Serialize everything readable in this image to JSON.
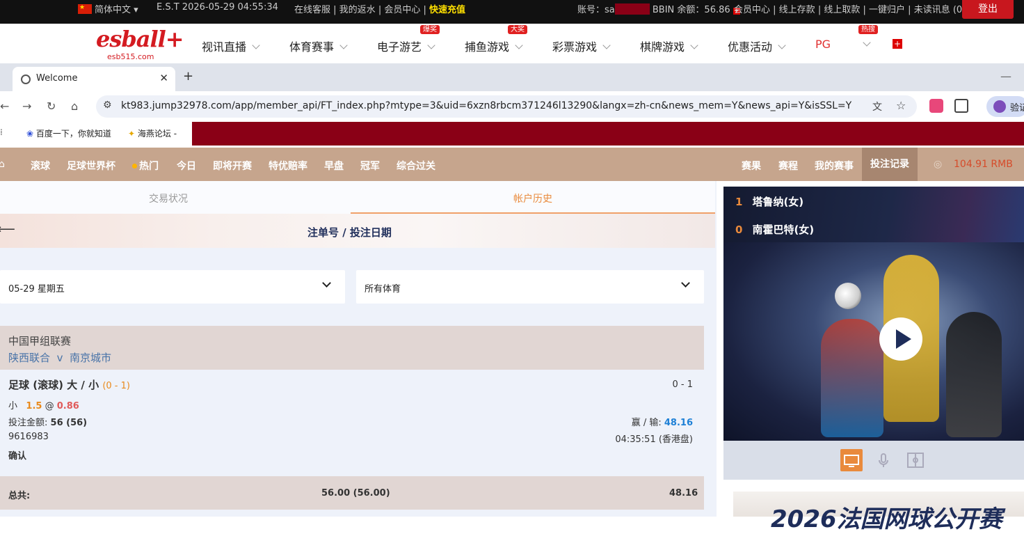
{
  "topbar": {
    "lang": "简体中文",
    "time": "E.S.T 2026-05-29 04:55:34",
    "links": [
      "在线客服",
      "我的返水",
      "会员中心"
    ],
    "recharge": "快速充值",
    "account_label": "账号：sa",
    "bbin_label": "BBIN 余额：",
    "bbin_value": "56.86",
    "right_links": [
      "会员中心",
      "线上存款",
      "线上取款",
      "一键归户",
      "未读讯息 (0)"
    ],
    "logout": "登出"
  },
  "logo": {
    "main": "esball+",
    "sub": "esb515.com"
  },
  "nav": {
    "items": [
      "视讯直播",
      "体育赛事",
      "电子游艺",
      "捕鱼游戏",
      "彩票游戏",
      "棋牌游戏",
      "优惠活动",
      "PG"
    ],
    "badges": [
      "爆奖",
      "大奖",
      "热搜"
    ]
  },
  "browser": {
    "tab_title": "Welcome",
    "url": "kt983.jump32978.com/app/member_api/FT_index.php?mtype=3&uid=6xzn8rbcm371246l13290&langx=zh-cn&news_mem=Y&news_api=Y&isSSL=Y",
    "bookmarks": [
      "百度一下，你就知道",
      "海燕论坛 -"
    ],
    "profile_label": "验证"
  },
  "sportnav": {
    "items": [
      "滚球",
      "足球世界杯",
      "热门",
      "今日",
      "即将开赛",
      "特优赔率",
      "早盘",
      "冠军",
      "综合过关"
    ],
    "right_items": [
      "赛果",
      "赛程",
      "我的赛事",
      "投注记录"
    ],
    "balance": "104.91  RMB"
  },
  "subtabs": [
    "交易状况",
    "帐户历史"
  ],
  "header_title": "注单号 / 投注日期",
  "filters": {
    "date": "05-29 星期五",
    "sport": "所有体育"
  },
  "bet": {
    "league": "中国甲组联赛",
    "home": "陕西联合",
    "vs": "v",
    "away": "南京城市",
    "market": "足球 (滚球) 大 / 小",
    "market_score": "(0 - 1)",
    "score_right": "0 - 1",
    "selection": "小",
    "line": "1.5",
    "at": "@",
    "odds": "0.86",
    "stake_label": "投注金额:",
    "stake": "56 (56)",
    "winloss_label": "赢 / 输:",
    "winloss": "48.16",
    "ticket": "9616983",
    "time": "04:35:51 (香港盘)",
    "status": "确认"
  },
  "total": {
    "label": "总共:",
    "stake": "56.00 (56.00)",
    "winloss": "48.16"
  },
  "live": {
    "home_score": "1",
    "home": "塔鲁纳(女)",
    "away_score": "0",
    "away": "南霍巴特(女)"
  },
  "banner_text": "2026法国网球公开赛"
}
